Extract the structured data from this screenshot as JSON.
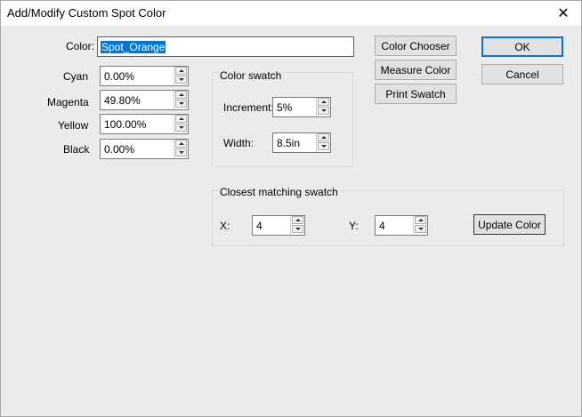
{
  "window": {
    "title": "Add/Modify Custom Spot Color"
  },
  "color": {
    "label": "Color:",
    "value": "Spot_Orange"
  },
  "cmyk": [
    {
      "label": "Cyan",
      "value": "0.00%"
    },
    {
      "label": "Magenta",
      "value": "49.80%"
    },
    {
      "label": "Yellow",
      "value": "100.00%"
    },
    {
      "label": "Black",
      "value": "0.00%"
    }
  ],
  "swatch": {
    "group_label": "Color swatch",
    "increment_label": "Increment:",
    "increment_value": "5%",
    "width_label": "Width:",
    "width_value": "8.5in"
  },
  "closest": {
    "group_label": "Closest matching swatch",
    "x_label": "X:",
    "x_value": "4",
    "y_label": "Y:",
    "y_value": "4",
    "update_label": "Update Color"
  },
  "buttons": {
    "color_chooser": "Color Chooser",
    "measure_color": "Measure Color",
    "print_swatch": "Print Swatch",
    "ok": "OK",
    "cancel": "Cancel"
  },
  "icons": {
    "close": "close-icon",
    "spin_up": "arrow-up-icon",
    "spin_down": "arrow-down-icon"
  }
}
